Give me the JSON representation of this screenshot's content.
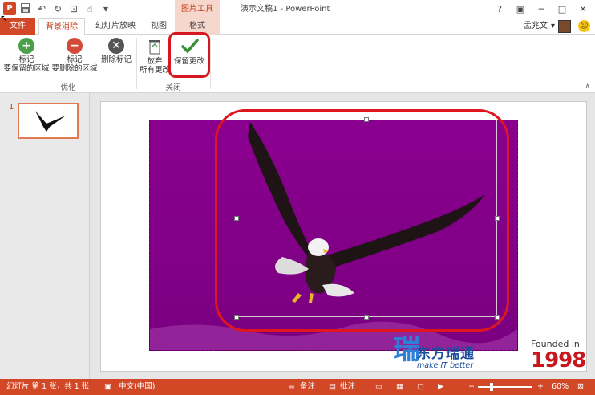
{
  "titlebar": {
    "tool_group_label": "图片工具",
    "window_title": "演示文稿1 - PowerPoint",
    "help": "?",
    "minimize": "─",
    "restore": "□",
    "close": "✕"
  },
  "tabs": {
    "file": "文件",
    "background_removal": "背景消除",
    "slideshow": "幻灯片放映",
    "view": "视图",
    "format": "格式"
  },
  "user": {
    "name": "孟兆文"
  },
  "ribbon": {
    "mark_keep": [
      "标记",
      "要保留的区域"
    ],
    "mark_remove": [
      "标记",
      "要删除的区域"
    ],
    "delete_mark": "删除标记",
    "discard": [
      "放弃",
      "所有更改"
    ],
    "keep_changes": "保留更改",
    "group_refine": "优化",
    "group_close": "关闭"
  },
  "slides": {
    "current_number": "1"
  },
  "watermark": {
    "ray_char": "瑞",
    "cn": "东方瑞通",
    "en": "make IT better",
    "founded": "Founded in",
    "year": "1998"
  },
  "statusbar": {
    "slide_info": "幻灯片 第 1 张，共 1 张",
    "language": "中文(中国)",
    "notes": "备注",
    "comments": "批注",
    "zoom_minus": "−",
    "zoom_plus": "+",
    "zoom_level": "60%"
  },
  "colors": {
    "accent": "#d24726",
    "photo_bg": "#8a008f",
    "highlight": "#e0161e"
  }
}
